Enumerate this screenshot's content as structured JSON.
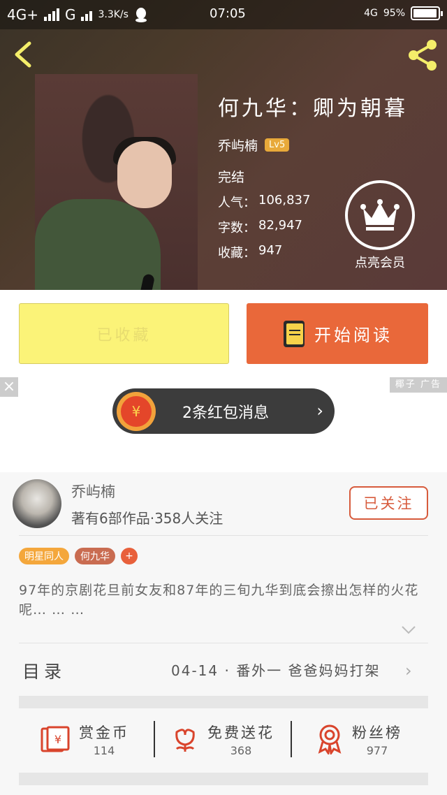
{
  "status_bar": {
    "network_left": "4G+",
    "network_g": "G",
    "speed": "3.3K/s",
    "time": "07:05",
    "network_right": "4G",
    "battery": "95%"
  },
  "book": {
    "title": "何九华：卿为朝暮",
    "author": "乔屿楠",
    "level": "Lv5",
    "status": "完结",
    "stats": [
      {
        "label": "人气：",
        "value": "106,837"
      },
      {
        "label": "字数：",
        "value": "82,947"
      },
      {
        "label": "收藏：",
        "value": "947"
      }
    ],
    "vip_label": "点亮会员"
  },
  "actions": {
    "collected_label": "已收藏",
    "read_label": "开始阅读"
  },
  "ad": {
    "close": "×",
    "label": "椰子 广告",
    "coin_symbol": "¥",
    "text": "2条红包消息",
    "arrow": "›"
  },
  "author_card": {
    "name": "乔屿楠",
    "meta": "著有6部作品·358人关注",
    "follow_label": "已关注",
    "tags": [
      "明星同人",
      "何九华"
    ],
    "tag_plus": "+",
    "intro": "97年的京剧花旦前女友和87年的三旬九华到底会擦出怎样的火花呢… … …"
  },
  "toc": {
    "label": "目录",
    "latest": "04-14 · 番外一  爸爸妈妈打架",
    "chevron": "›"
  },
  "stats_row": [
    {
      "label": "赏金币",
      "value": "114",
      "icon": "red-envelope-icon"
    },
    {
      "label": "免费送花",
      "value": "368",
      "icon": "flower-icon"
    },
    {
      "label": "粉丝榜",
      "value": "977",
      "icon": "medal-icon"
    }
  ],
  "colors": {
    "accent": "#e9683a",
    "collected_bg": "#fbf378",
    "follow": "#d75b3c"
  }
}
